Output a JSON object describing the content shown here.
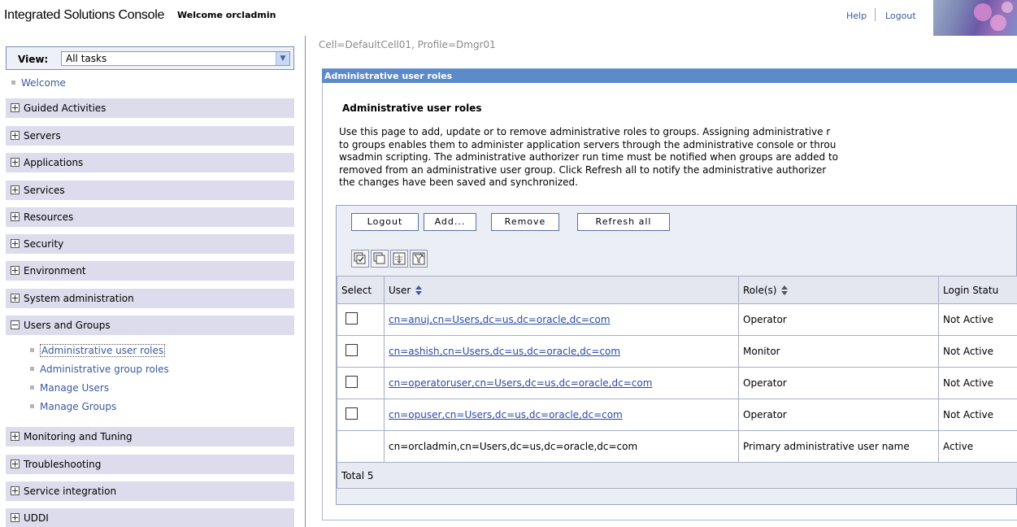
{
  "banner": {
    "app_title": "Integrated Solutions Console",
    "welcome": "Welcome orcladmin",
    "help": "Help",
    "logout": "Logout"
  },
  "nav": {
    "view_label": "View:",
    "view_value": "All tasks",
    "welcome": "Welcome",
    "items": [
      "Guided Activities",
      "Servers",
      "Applications",
      "Services",
      "Resources",
      "Security",
      "Environment",
      "System administration",
      "Users and Groups",
      "Monitoring and Tuning",
      "Troubleshooting",
      "Service integration",
      "UDDI"
    ],
    "users_and_groups_children": [
      "Administrative user roles",
      "Administrative group roles",
      "Manage Users",
      "Manage Groups"
    ]
  },
  "main": {
    "cell_profile": "Cell=DefaultCell01, Profile=Dmgr01",
    "portlet_title": "Administrative user roles",
    "heading": "Administrative user roles",
    "description_lines": [
      "Use this page to add, update or to remove administrative roles to groups. Assigning administrative r",
      "to groups enables them to administer application servers through the administrative console or throu",
      "wsadmin scripting. The administrative authorizer run time must be notified when groups are added to",
      "removed from an administrative user group. Click Refresh all to notify the administrative authorizer",
      "the changes have been saved and synchronized."
    ],
    "buttons": {
      "logout": "Logout",
      "add": "Add...",
      "remove": "Remove",
      "refresh_all": "Refresh all"
    },
    "columns": {
      "select": "Select",
      "user": "User",
      "roles": "Role(s)",
      "login_status": "Login Statu"
    },
    "rows": [
      {
        "user": "cn=anuj,cn=Users,dc=us,dc=oracle,dc=com",
        "role": "Operator",
        "status": "Not Active"
      },
      {
        "user": "cn=ashish,cn=Users,dc=us,dc=oracle,dc=com",
        "role": "Monitor",
        "status": "Not Active"
      },
      {
        "user": "cn=operatoruser,cn=Users,dc=us,dc=oracle,dc=com",
        "role": "Operator",
        "status": "Not Active"
      },
      {
        "user": "cn=opuser,cn=Users,dc=us,dc=oracle,dc=com",
        "role": "Operator",
        "status": "Not Active"
      },
      {
        "user": "cn=orcladmin,cn=Users,dc=us,dc=oracle,dc=com",
        "role": "Primary administrative user name",
        "status": "Active"
      }
    ],
    "total": "Total 5"
  }
}
